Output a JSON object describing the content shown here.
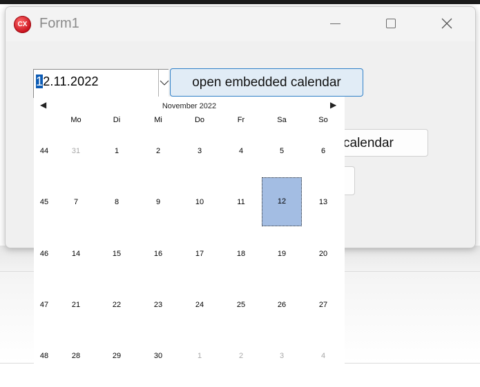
{
  "window": {
    "title": "Form1",
    "icon_text": "CX"
  },
  "datepicker": {
    "value_selected": "1",
    "value_rest": "2.11.2022"
  },
  "buttons": {
    "embedded": "open embedded calendar",
    "calendar": "calendar"
  },
  "calendar": {
    "month": "November 2022",
    "prev": "◀",
    "next": "▶",
    "weekdays": [
      "Mo",
      "Di",
      "Mi",
      "Do",
      "Fr",
      "Sa",
      "So"
    ],
    "weeks": [
      {
        "num": "44",
        "days": [
          "31",
          "1",
          "2",
          "3",
          "4",
          "5",
          "6"
        ]
      },
      {
        "num": "45",
        "days": [
          "7",
          "8",
          "9",
          "10",
          "11",
          "12",
          "13"
        ]
      },
      {
        "num": "46",
        "days": [
          "14",
          "15",
          "16",
          "17",
          "18",
          "19",
          "20"
        ]
      },
      {
        "num": "47",
        "days": [
          "21",
          "22",
          "23",
          "24",
          "25",
          "26",
          "27"
        ]
      },
      {
        "num": "48",
        "days": [
          "28",
          "29",
          "30",
          "1",
          "2",
          "3",
          "4"
        ]
      }
    ],
    "selected_day": "12"
  },
  "colors": {
    "selection": "#0c5bb4",
    "selected_day_bg": "#a3bde3",
    "button_focus_border": "#2f7fc7",
    "other_month_text": "#a8a8a8"
  }
}
